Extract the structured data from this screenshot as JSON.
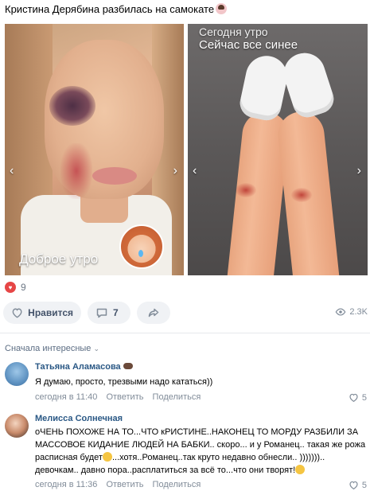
{
  "post": {
    "title": "Кристина Дерябина разбилась на самокате",
    "photos": [
      {
        "overlay_text": "Доброе утро"
      },
      {
        "overlay_text_top": "Сейчас все синее",
        "overlay_text_faded": "Сегодня утро"
      }
    ],
    "reactions_count": "9",
    "actions": {
      "like_label": "Нравится",
      "comment_count": "7"
    },
    "views": "2.3K"
  },
  "comments_section": {
    "sort_label": "Сначала интересные"
  },
  "comments": [
    {
      "author": "Татьяна Аламасова",
      "text": "Я думаю, просто, трезвыми надо кататься))",
      "time": "сегодня в 11:40",
      "reply_label": "Ответить",
      "share_label": "Поделиться",
      "likes": "5"
    },
    {
      "author": "Мелисса Солнечная",
      "text": "оЧЕНЬ ПОХОЖЕ НА ТО...ЧТО кРИСТИНЕ..НАКОНЕЦ ТО МОРДУ РАЗБИЛИ ЗА МАССОВОЕ КИДАНИЕ ЛЮДЕЙ НА БАБКИ.. скоро... и у Романец.. такая же рожа расписная будет",
      "text_cont": "...хотя..Романец..так круто недавно обнесли.. ))))))).. девочкам.. давно пора..расплатиться за всё то...что они творят!",
      "time": "сегодня в 11:36",
      "reply_label": "Ответить",
      "share_label": "Поделиться",
      "likes": "5"
    }
  ],
  "icons": {
    "heart": "heart-icon",
    "comment": "comment-icon",
    "share": "share-icon",
    "eye": "eye-icon",
    "chevron": "chevron-down-icon"
  },
  "colors": {
    "accent": "#2a5885",
    "heart": "#e64646",
    "pill_bg": "#f0f2f5",
    "meta": "#818c99"
  }
}
